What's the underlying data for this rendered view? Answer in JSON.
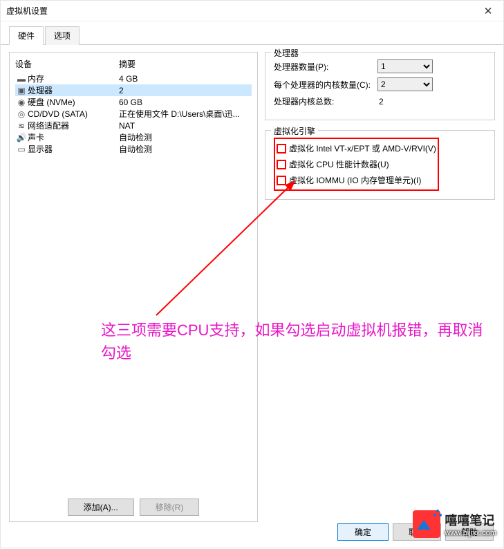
{
  "window": {
    "title": "虚拟机设置"
  },
  "tabs": {
    "hardware": "硬件",
    "options": "选项"
  },
  "device_list": {
    "header_name": "设备",
    "header_summary": "摘要",
    "items": [
      {
        "icon": "memory-icon",
        "name": "内存",
        "summary": "4 GB"
      },
      {
        "icon": "cpu-icon",
        "name": "处理器",
        "summary": "2"
      },
      {
        "icon": "disk-icon",
        "name": "硬盘 (NVMe)",
        "summary": "60 GB"
      },
      {
        "icon": "cd-icon",
        "name": "CD/DVD (SATA)",
        "summary": "正在使用文件 D:\\Users\\桌面\\迅..."
      },
      {
        "icon": "net-icon",
        "name": "网络适配器",
        "summary": "NAT"
      },
      {
        "icon": "sound-icon",
        "name": "声卡",
        "summary": "自动检测"
      },
      {
        "icon": "display-icon",
        "name": "显示器",
        "summary": "自动检测"
      }
    ],
    "selected_index": 1,
    "add_button": "添加(A)...",
    "remove_button": "移除(R)"
  },
  "processor_panel": {
    "group_title": "处理器",
    "num_processors_label": "处理器数量(P):",
    "num_processors_value": "1",
    "cores_per_label": "每个处理器的内核数量(C):",
    "cores_per_value": "2",
    "total_label": "处理器内核总数:",
    "total_value": "2"
  },
  "virt_engine": {
    "group_title": "虚拟化引擎",
    "opt_vt": "虚拟化 Intel VT-x/EPT 或 AMD-V/RVI(V)",
    "opt_perf": "虚拟化 CPU 性能计数器(U)",
    "opt_iommu": "虚拟化 IOMMU (IO 内存管理单元)(I)"
  },
  "annotation": {
    "text": "这三项需要CPU支持，如果勾选启动虚拟机报错，再取消勾选"
  },
  "dialog": {
    "ok": "确定",
    "cancel": "取消",
    "help": "帮助"
  },
  "watermark": {
    "brand": "嘻嘻笔记",
    "url": "www.bijixx.com"
  }
}
